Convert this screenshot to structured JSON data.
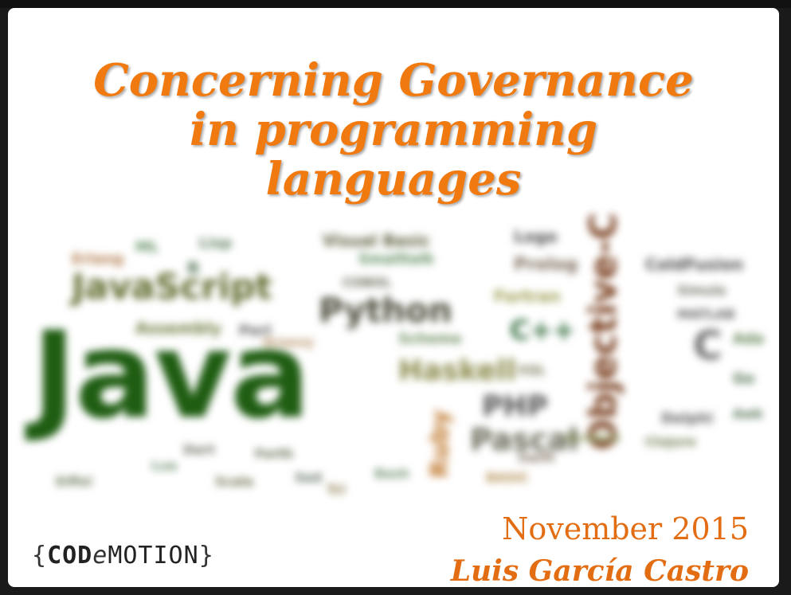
{
  "title": {
    "line1": "Concerning Governance",
    "line2": "in programming",
    "line3": "languages"
  },
  "date": "November 2015",
  "author": "Luis García Castro",
  "logo": {
    "open": "{",
    "cod": "COD",
    "e": "e",
    "motion": "MOTION",
    "close": "}"
  },
  "cloud": {
    "java": "Java",
    "javascript": "JavaScript",
    "python": "Python",
    "cpp": "C++",
    "haskell": "Haskell",
    "php": "PHP",
    "pascal": "Pascal",
    "objc": "Objective-C",
    "c": "C",
    "ruby": "Ruby",
    "visualbasic": "Visual Basic",
    "assembly": "Assembly",
    "logo_lang": "Logo",
    "prolog": "Prolog",
    "coldfusion": "ColdFusion",
    "scheme": "Scheme",
    "fortran": "Fortran",
    "erlang": "Erlang",
    "perl": "Perl",
    "lisp": "Lisp",
    "delphi": "Delphi",
    "smalltalk": "Smalltalk",
    "ada": "Ada",
    "cobol": "COBOL",
    "scala": "Scala",
    "lua": "Lua",
    "go": "Go",
    "sql": "SQL",
    "tcl": "Tcl",
    "groovy": "Groovy",
    "matlab": "MATLAB",
    "r_lang": "R",
    "clojure": "Clojure",
    "basic": "BASIC",
    "forth": "Forth",
    "ml": "ML",
    "scratch": "Scratch",
    "awk": "Awk",
    "eiffel": "Eiffel",
    "simula": "Simula",
    "bash": "Bash",
    "sed": "Sed",
    "swift": "Swift",
    "dart": "Dart"
  },
  "colors": {
    "title": "#f07a10",
    "accent": "#e36d12",
    "java_green": "#1f5d12"
  }
}
